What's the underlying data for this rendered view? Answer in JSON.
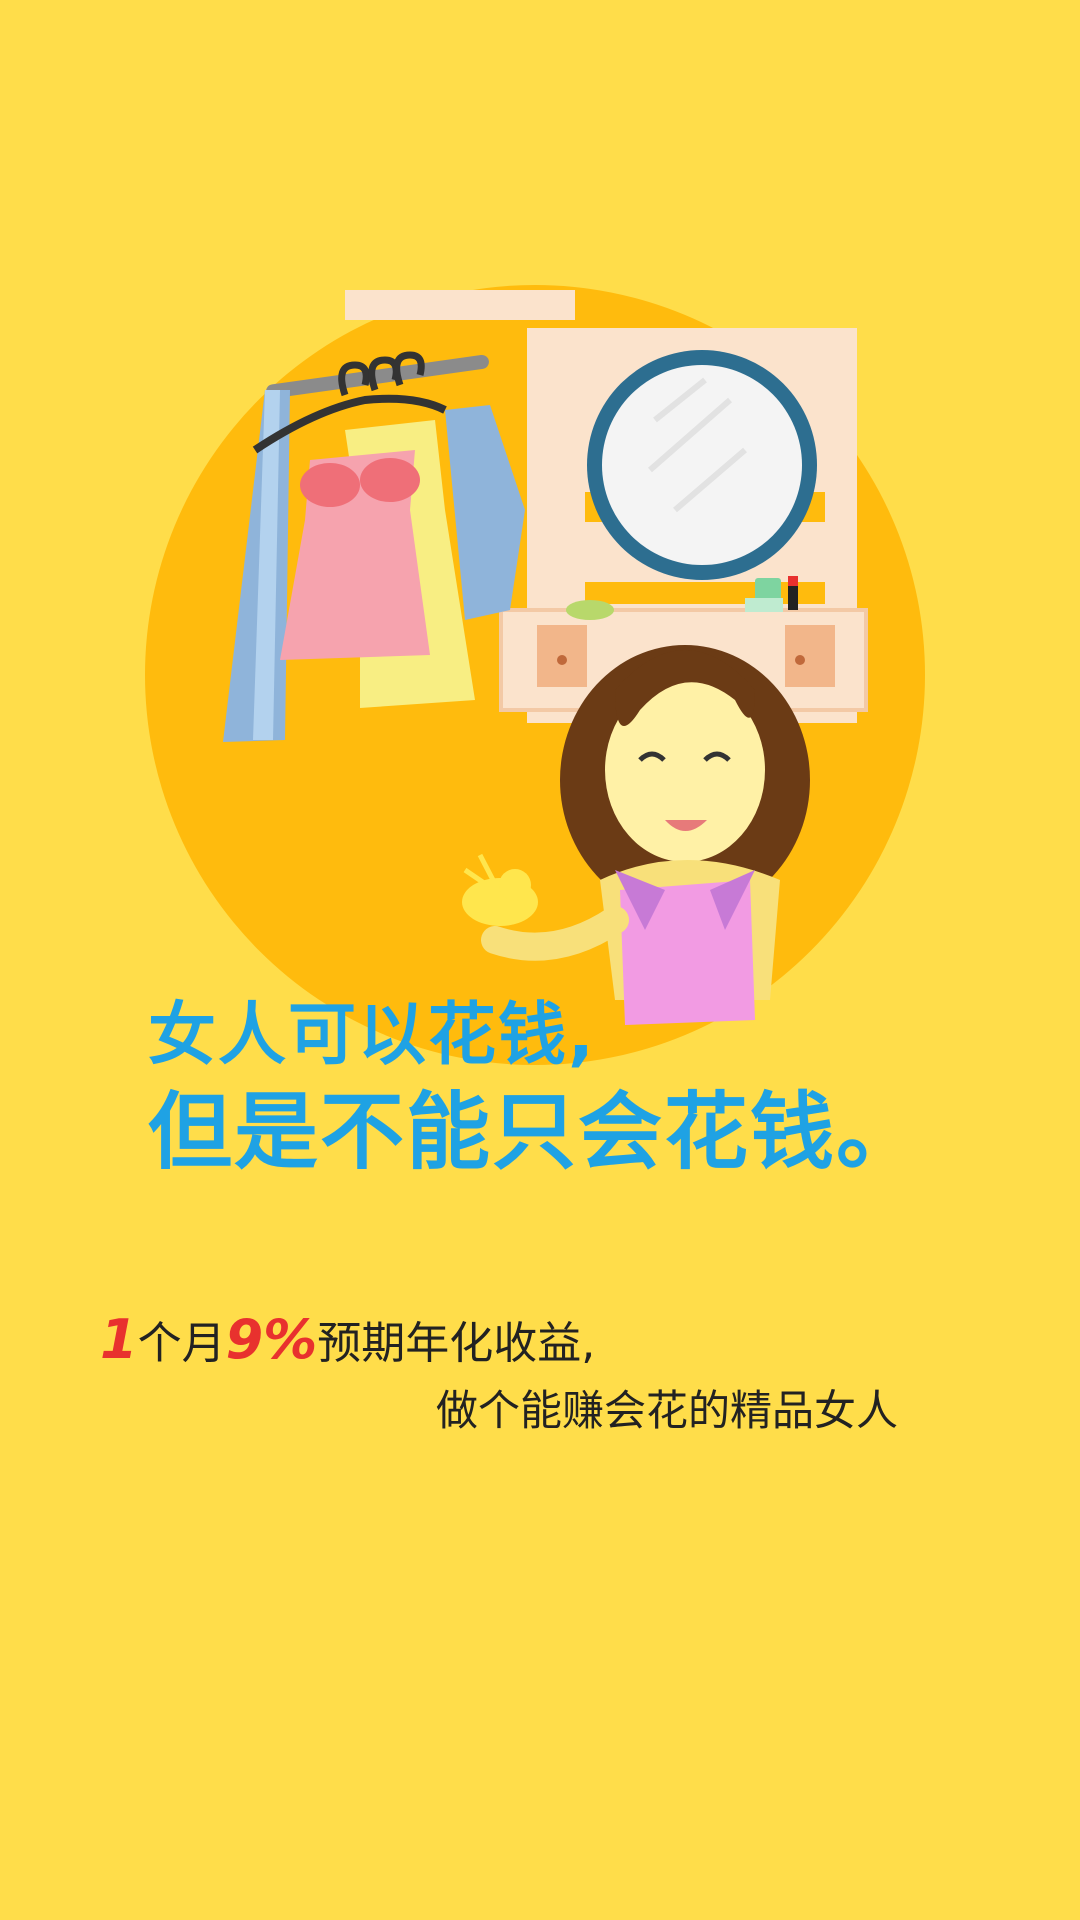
{
  "headline": {
    "line1": "女人可以花钱,",
    "line2": "但是不能只会花钱。"
  },
  "promo": {
    "number1": "1",
    "text1": "个月",
    "number2": "9%",
    "text2": "预期年化收益,",
    "line2": "做个能赚会花的精品女人"
  },
  "colors": {
    "background": "#FFDD4A",
    "circle": "#FFBB0D",
    "headline": "#1FA2E4",
    "highlight": "#E8312E"
  },
  "icons": {
    "illustration": "woman-with-wardrobe-and-mirror-illustration"
  }
}
